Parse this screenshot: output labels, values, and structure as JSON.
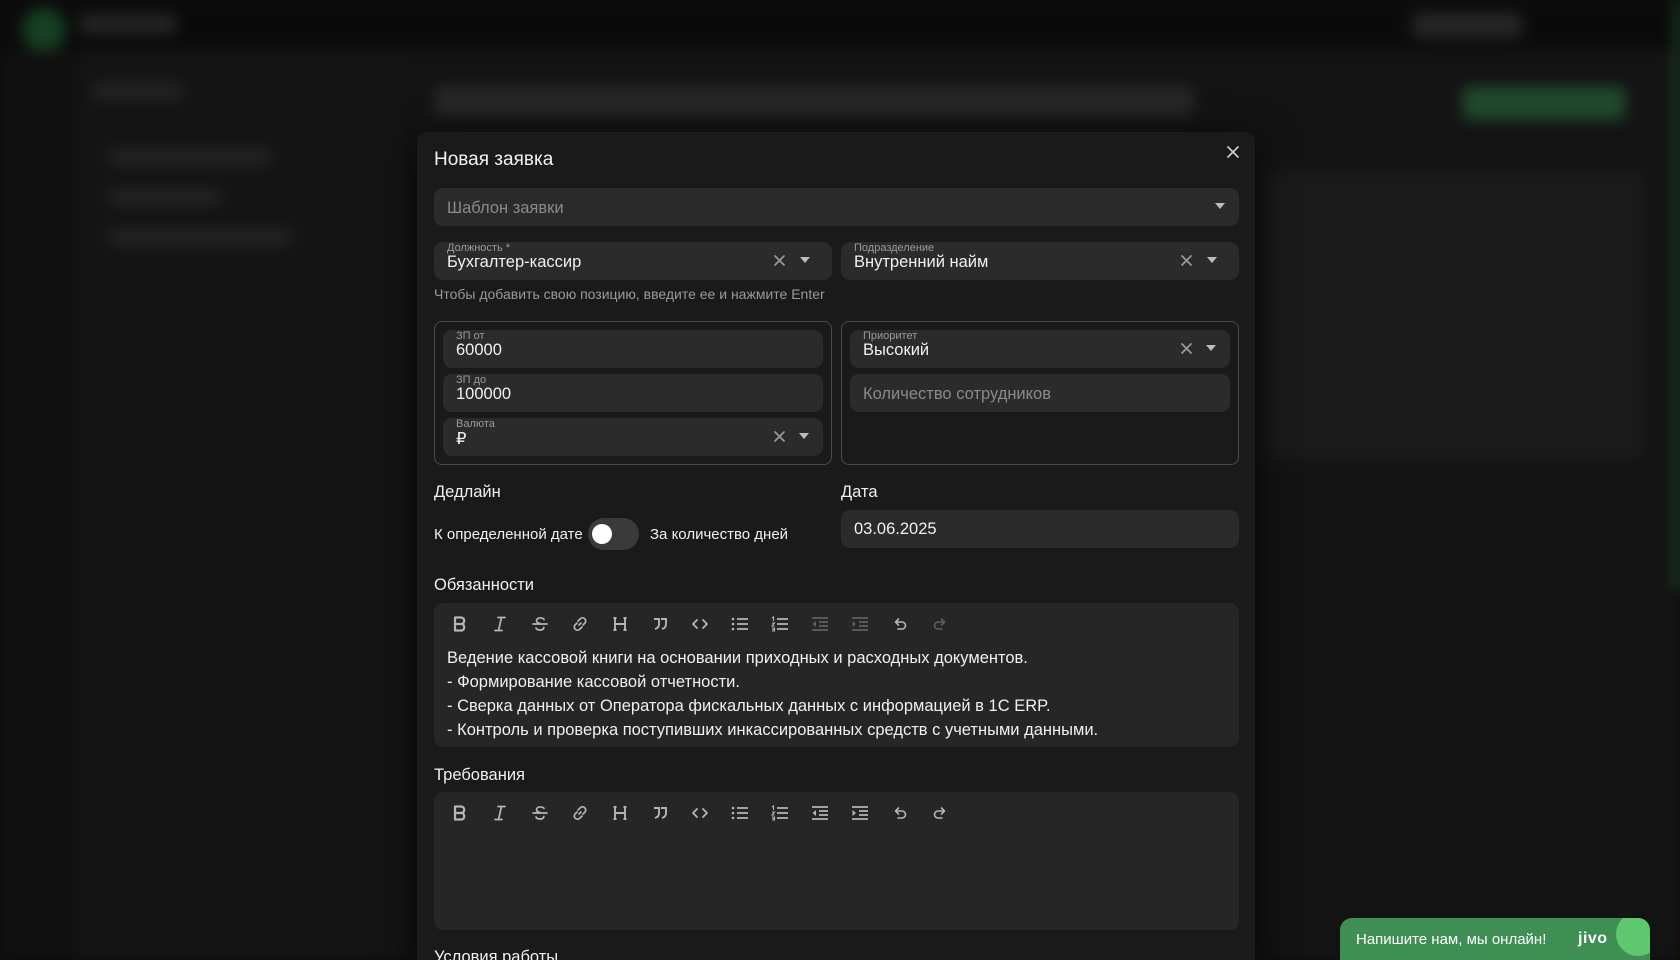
{
  "modal": {
    "title": "Новая заявка",
    "template_placeholder": "Шаблон заявки",
    "position": {
      "label": "Должность *",
      "value": "Бухгалтер-кассир"
    },
    "department": {
      "label": "Подразделение",
      "value": "Внутренний найм"
    },
    "hint": "Чтобы добавить свою позицию, введите ее и нажмите Enter",
    "salary_from": {
      "label": "ЗП от",
      "value": "60000"
    },
    "salary_to": {
      "label": "ЗП до",
      "value": "100000"
    },
    "currency": {
      "label": "Валюта",
      "value": "₽"
    },
    "priority": {
      "label": "Приоритет",
      "value": "Высокий"
    },
    "employee_count_placeholder": "Количество сотрудников",
    "deadline": {
      "label": "Дедлайн",
      "option_left": "К определенной дате",
      "option_right": "За количество дней",
      "toggle_on": false
    },
    "date": {
      "label": "Дата",
      "value": "03.06.2025"
    },
    "duties": {
      "label": "Обязанности",
      "lines": [
        "Ведение кассовой книги на основании приходных и расходных документов.",
        "- Формирование кассовой отчетности.",
        "- Сверка данных от Оператора фискальных данных с информацией в 1С ERP.",
        "- Контроль и проверка поступивших инкассированных средств с учетными данными."
      ]
    },
    "requirements": {
      "label": "Требования",
      "lines": []
    },
    "next_section": "Условия работы"
  },
  "toolbar_icons": [
    "bold-icon",
    "italic-icon",
    "strikethrough-icon",
    "link-icon",
    "heading-icon",
    "quote-icon",
    "code-icon",
    "bullet-list-icon",
    "ordered-list-icon",
    "outdent-icon",
    "indent-icon",
    "undo-icon",
    "redo-icon"
  ],
  "chat_widget": {
    "text": "Напишите нам, мы онлайн!",
    "brand": "jivo"
  },
  "colors": {
    "accent": "#3f8f55",
    "modal_bg": "#1a1a1a",
    "field_bg": "#2b2b2b"
  }
}
